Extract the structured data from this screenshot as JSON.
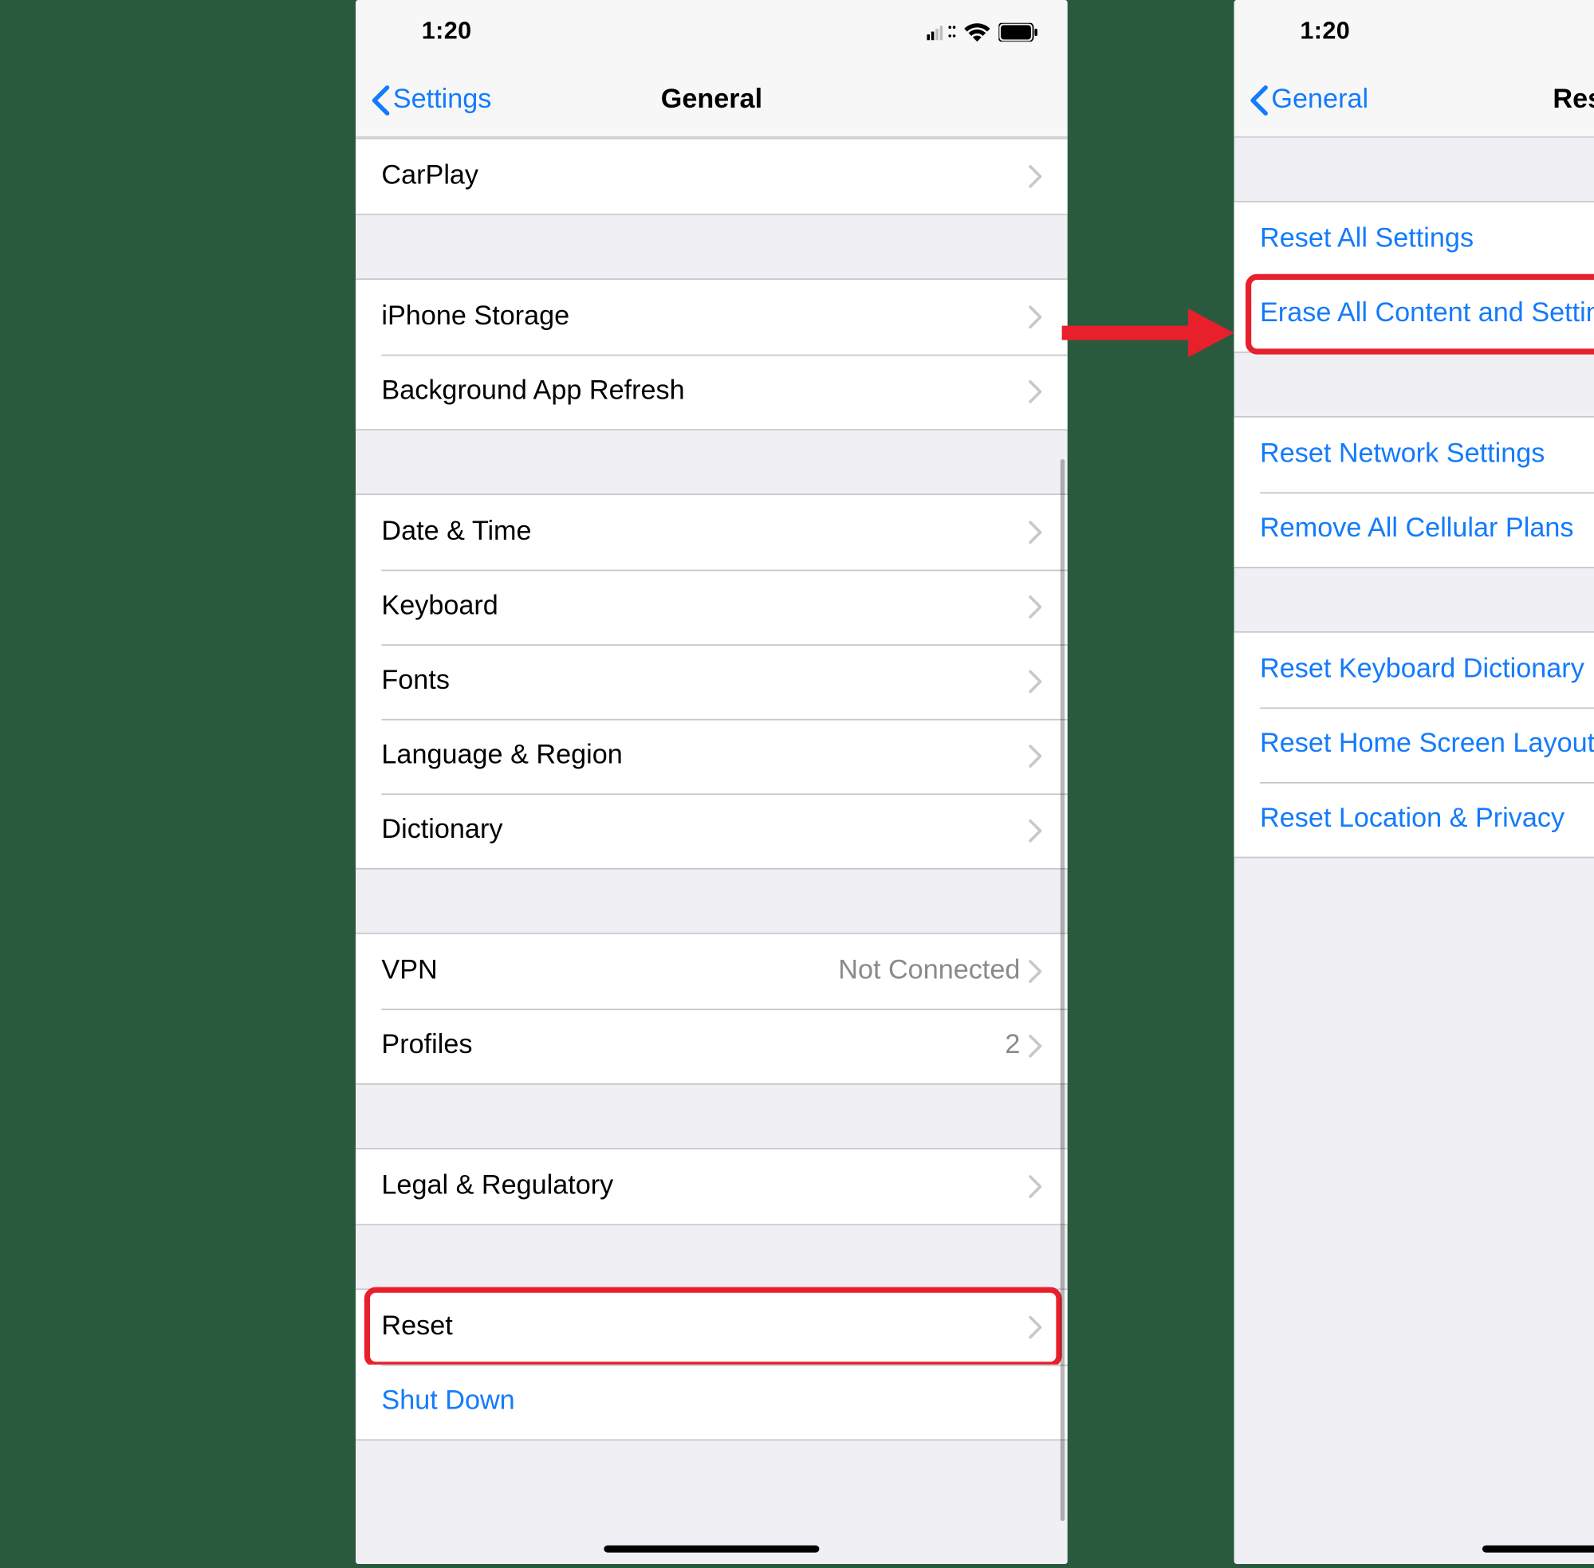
{
  "status": {
    "time": "1:20",
    "cellular_icon": "cellular-dual-icon",
    "wifi_icon": "wifi-icon",
    "battery_icon": "battery-icon"
  },
  "left": {
    "nav": {
      "back_label": "Settings",
      "title": "General"
    },
    "groups": [
      {
        "rows": [
          {
            "label": "CarPlay",
            "chevron": true
          }
        ]
      },
      {
        "rows": [
          {
            "label": "iPhone Storage",
            "chevron": true
          },
          {
            "label": "Background App Refresh",
            "chevron": true
          }
        ]
      },
      {
        "rows": [
          {
            "label": "Date & Time",
            "chevron": true
          },
          {
            "label": "Keyboard",
            "chevron": true
          },
          {
            "label": "Fonts",
            "chevron": true
          },
          {
            "label": "Language & Region",
            "chevron": true
          },
          {
            "label": "Dictionary",
            "chevron": true
          }
        ]
      },
      {
        "rows": [
          {
            "label": "VPN",
            "detail": "Not Connected",
            "chevron": true
          },
          {
            "label": "Profiles",
            "detail": "2",
            "chevron": true
          }
        ]
      },
      {
        "rows": [
          {
            "label": "Legal & Regulatory",
            "chevron": true
          }
        ]
      },
      {
        "rows": [
          {
            "label": "Reset",
            "chevron": true,
            "highlight": true
          },
          {
            "label": "Shut Down",
            "blue": true
          }
        ]
      }
    ]
  },
  "right": {
    "nav": {
      "back_label": "General",
      "title": "Reset"
    },
    "groups": [
      {
        "rows": [
          {
            "label": "Reset All Settings",
            "blue": true
          },
          {
            "label": "Erase All Content and Settings",
            "blue": true,
            "highlight": true
          }
        ]
      },
      {
        "rows": [
          {
            "label": "Reset Network Settings",
            "blue": true
          },
          {
            "label": "Remove All Cellular Plans",
            "blue": true
          }
        ]
      },
      {
        "rows": [
          {
            "label": "Reset Keyboard Dictionary",
            "blue": true
          },
          {
            "label": "Reset Home Screen Layout",
            "blue": true
          },
          {
            "label": "Reset Location & Privacy",
            "blue": true
          }
        ]
      }
    ]
  },
  "annotation": {
    "arrow_color": "#e7202b",
    "highlight_color": "#e7202b"
  }
}
